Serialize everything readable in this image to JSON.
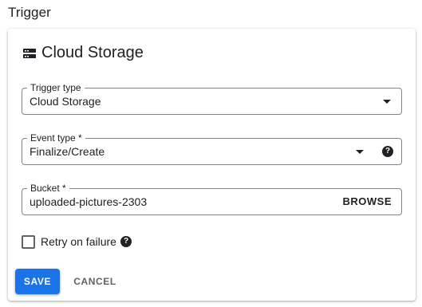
{
  "section": {
    "title": "Trigger"
  },
  "card": {
    "title": "Cloud Storage",
    "icon": "storage-icon"
  },
  "trigger_type": {
    "label": "Trigger type",
    "value": "Cloud Storage",
    "icon": "chevron-down-icon"
  },
  "event_type": {
    "label": "Event type *",
    "value": "Finalize/Create",
    "icon": "chevron-down-icon",
    "help_icon": "help-icon",
    "help_glyph": "?"
  },
  "bucket": {
    "label": "Bucket *",
    "value": "uploaded-pictures-2303",
    "browse_label": "BROWSE"
  },
  "retry": {
    "label": "Retry on failure",
    "checked": false,
    "help_icon": "help-icon",
    "help_glyph": "?"
  },
  "actions": {
    "save_label": "SAVE",
    "cancel_label": "CANCEL"
  },
  "colors": {
    "primary": "#1a73e8",
    "text": "#202124",
    "secondary_text": "#5f6368",
    "border": "#80868b"
  }
}
